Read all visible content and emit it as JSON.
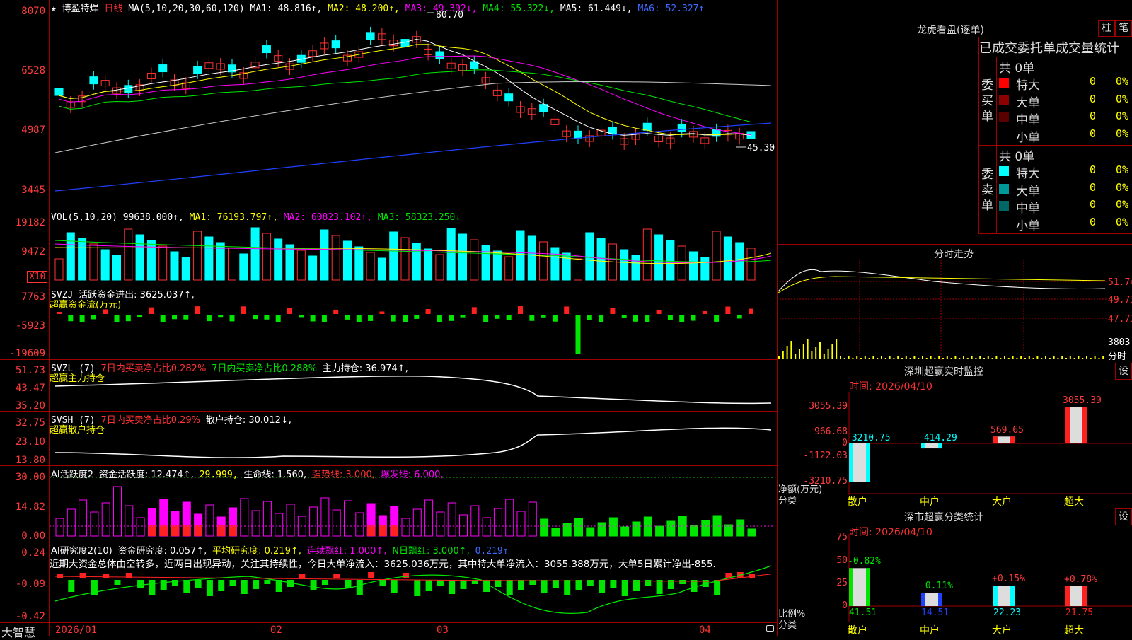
{
  "header": {
    "star": "★",
    "stock_name": "博盈特焊",
    "period": "日线",
    "ma_params": "MA(5,10,20,30,60,120)",
    "ma1": "MA1: 48.816↑,",
    "ma2": "MA2: 48.200↑,",
    "ma3": "MA3: 49.392↓,",
    "ma4": "MA4: 55.322↓,",
    "ma5": "MA5: 61.449↓,",
    "ma6": "MA6: 52.327↑",
    "high_label": "80.70",
    "low_label": "45.30"
  },
  "price_axis": [
    "8070",
    "6528",
    "4987",
    "3445"
  ],
  "volume": {
    "title": "VOL(5,10,20)",
    "value": "99638.000↑,",
    "ma1": "MA1: 76193.797↑,",
    "ma2": "MA2: 60823.102↑,",
    "ma3": "MA3: 58323.250↓",
    "axis": [
      "19182",
      "9472"
    ],
    "unit": "X10"
  },
  "svzj": {
    "title": "SVZJ",
    "label": "活跃资金进出: 3625.037↑,",
    "sub": "超赢资金流(万元)",
    "axis": [
      "7763",
      "-5923",
      "-19609"
    ]
  },
  "svzl": {
    "title": "SVZL (7)",
    "a": "7日内买卖净占比0.282%",
    "b": "7日内买卖净占比0.288%",
    "c": "主力持仓: 36.974↑,",
    "sub": "超赢主力持仓",
    "axis": [
      "51.73",
      "43.47",
      "35.20"
    ]
  },
  "svsh": {
    "title": "SVSH (7)",
    "a": "7日内买卖净占比0.29%",
    "b": "散户持仓: 30.012↓,",
    "sub": "超赢散户持仓",
    "axis": [
      "32.75",
      "23.10",
      "13.80"
    ]
  },
  "ai1": {
    "title": "AI活跃度2",
    "a": "资金活跃度: 12.474↑,",
    "b": "29.999,",
    "c": "生命线: 1.560,",
    "d": "强势线: 3.000,",
    "e": "爆发线: 6.000,",
    "axis": [
      "30.00",
      "14.82",
      "0.00"
    ]
  },
  "ai2": {
    "title": "AI研究度2(10)",
    "a": "资金研究度: 0.057↑,",
    "b": "平均研究度: 0.219↑,",
    "c": "连续飘红: 1.000↑,",
    "d": "N日飘红: 3.000↑,",
    "e": "0.219↑",
    "text": "近期大资金总体由空转多，近两日出现异动，关注其持续性，今日大单净流入：3625.036万元，其中特大单净流入：3055.388万元，大单5日累计净出-855.",
    "axis": [
      "0.24",
      "-0.09",
      "-0.42"
    ]
  },
  "time_axis": [
    "2026/01",
    "02",
    "03",
    "04"
  ],
  "brand": "大智慧",
  "right": {
    "title": "龙虎看盘(逐单)",
    "btn1": "柱",
    "btn2": "笔",
    "header": "已成交委托单成交量统计",
    "buy_label": "委买单",
    "sell_label": "委卖单",
    "buy_total": "共 0单",
    "sell_total": "共 0单",
    "buy_rows": [
      {
        "name": "特大",
        "count": "0",
        "pct": "0%",
        "color": "#ff0000"
      },
      {
        "name": "大单",
        "count": "0",
        "pct": "0%",
        "color": "#8b0000"
      },
      {
        "name": "中单",
        "count": "0",
        "pct": "0%",
        "color": "#5a0000"
      },
      {
        "name": "小单",
        "count": "0",
        "pct": "0%",
        "color": "#000000"
      }
    ],
    "sell_rows": [
      {
        "name": "特大",
        "count": "0",
        "pct": "0%",
        "color": "#00ffff"
      },
      {
        "name": "大单",
        "count": "0",
        "pct": "0%",
        "color": "#009999"
      },
      {
        "name": "中单",
        "count": "0",
        "pct": "0%",
        "color": "#006666"
      },
      {
        "name": "小单",
        "count": "0",
        "pct": "0%",
        "color": "#000000"
      }
    ],
    "intraday_title": "分时走势",
    "intraday_axis": [
      "51.74",
      "49.73",
      "47.73",
      "3803"
    ],
    "intraday_unit": "分时",
    "monitor_title": "深圳超赢实时监控",
    "monitor_time": "时间: 2026/04/10",
    "monitor_btn": "设",
    "monitor_axis": [
      "3055.39",
      "966.68",
      "0",
      "-1122.03",
      "-3210.75"
    ],
    "monitor_unit1": "净额(万元)",
    "monitor_unit2": "分类",
    "monitor_bars": [
      {
        "cat": "散户",
        "value": -3210.75,
        "label": "-3210.75"
      },
      {
        "cat": "中户",
        "value": -414.29,
        "label": "-414.29"
      },
      {
        "cat": "大户",
        "value": 569.65,
        "label": "569.65"
      },
      {
        "cat": "超大",
        "value": 3055.39,
        "label": "3055.39"
      }
    ],
    "class_title": "深市超赢分类统计",
    "class_time": "时间: 2026/04/10",
    "class_btn": "设",
    "class_axis": [
      "75",
      "50",
      "25",
      "0"
    ],
    "class_unit1": "比例%",
    "class_unit2": "分类",
    "class_bars": [
      {
        "cat": "散户",
        "value": 41.51,
        "label": "41.51",
        "change": "-0.82%"
      },
      {
        "cat": "中户",
        "value": 14.51,
        "label": "14.51",
        "change": "-0.11%"
      },
      {
        "cat": "大户",
        "value": 22.23,
        "label": "22.23",
        "change": "+0.15%"
      },
      {
        "cat": "超大",
        "value": 21.75,
        "label": "21.75",
        "change": "+0.78%"
      }
    ]
  }
}
